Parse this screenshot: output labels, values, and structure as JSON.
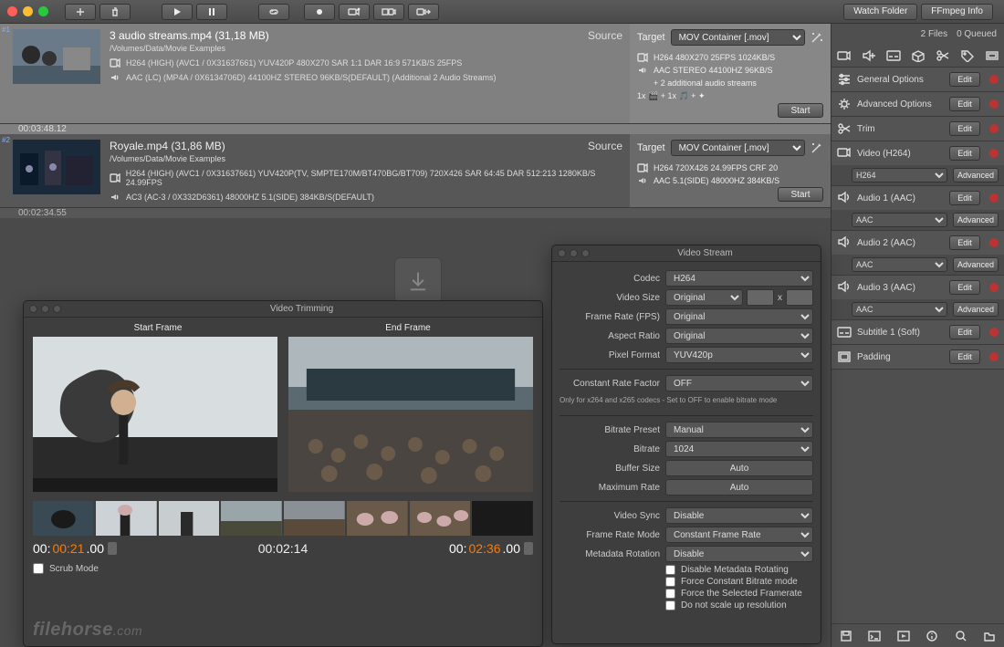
{
  "toolbar": {
    "watch_folder": "Watch Folder",
    "ffmpeg_info": "FFmpeg Info"
  },
  "status": {
    "files": "2 Files",
    "queued": "0 Queued"
  },
  "queue": [
    {
      "idx": "#1",
      "title": "3 audio streams.mp4  (31,18 MB)",
      "path": "/Volumes/Data/Movie Examples",
      "video_spec": "H264 (HIGH) (AVC1 / 0X31637661)  YUV420P 480X270 SAR 1:1 DAR 16:9 571KB/S 25FPS",
      "audio_spec": "AAC (LC) (MP4A / 0X6134706D) 44100HZ STEREO 96KB/S(DEFAULT) (Additional 2 Audio Streams)",
      "duration": "00:03:48.12",
      "source_label": "Source",
      "target": {
        "label": "Target",
        "container": "MOV Container [.mov]",
        "lines": [
          "H264 480X270 25FPS 1024KB/S",
          "AAC STEREO 44100HZ 96KB/S",
          "+ 2 additional audio streams"
        ],
        "mix": "1x 🎬 + 1x 🎵 + ✦",
        "start": "Start"
      }
    },
    {
      "idx": "#2",
      "title": "Royale.mp4  (31,86 MB)",
      "path": "/Volumes/Data/Movie Examples",
      "video_spec": "H264 (HIGH) (AVC1 / 0X31637661)  YUV420P(TV, SMPTE170M/BT470BG/BT709) 720X426 SAR 64:45 DAR 512:213 1280KB/S 24.99FPS",
      "audio_spec": "AC3 (AC-3 / 0X332D6361) 48000HZ 5.1(SIDE) 384KB/S(DEFAULT)",
      "duration": "00:02:34.55",
      "source_label": "Source",
      "target": {
        "label": "Target",
        "container": "MOV Container [.mov]",
        "lines": [
          "H264 720X426 24.99FPS CRF 20",
          "AAC 5.1(SIDE) 48000HZ 384KB/S"
        ],
        "start": "Start"
      }
    }
  ],
  "trimming": {
    "title": "Video Trimming",
    "start_head": "Start Frame",
    "end_head": "End Frame",
    "start_tc_pre": "00:",
    "start_tc_hl": "00:21",
    "start_tc_post": ".00",
    "mid_tc": "00:02:14",
    "end_tc_pre": "00:",
    "end_tc_hl": "02:36",
    "end_tc_post": ".00",
    "scrub": "Scrub Mode",
    "watermark": "filehorse",
    "watermark_dom": ".com"
  },
  "video_stream": {
    "title": "Video Stream",
    "labels": {
      "codec": "Codec",
      "videosize": "Video Size",
      "fps": "Frame Rate (FPS)",
      "aspect": "Aspect Ratio",
      "pixfmt": "Pixel Format",
      "crf": "Constant Rate Factor",
      "note": "Only for x264 and x265 codecs   -   Set to OFF to enable bitrate mode",
      "preset": "Bitrate Preset",
      "bitrate": "Bitrate",
      "buffer": "Buffer Size",
      "maxrate": "Maximum Rate",
      "vsync": "Video Sync",
      "frmode": "Frame Rate Mode",
      "mrot": "Metadata Rotation",
      "auto": "Auto"
    },
    "values": {
      "codec": "H264",
      "videosize": "Original",
      "fps": "Original",
      "aspect": "Original",
      "pixfmt": "YUV420p",
      "crf": "OFF",
      "preset": "Manual",
      "bitrate": "1024",
      "vsync": "Disable",
      "frmode": "Constant Frame Rate",
      "mrot": "Disable",
      "x": "x"
    },
    "checks": [
      "Disable Metadata Rotating",
      "Force Constant Bitrate mode",
      "Force the Selected Framerate",
      "Do not scale up resolution"
    ]
  },
  "sidebar": {
    "sections": [
      {
        "label": "General Options",
        "btn": "Edit",
        "adv": false
      },
      {
        "label": "Advanced Options",
        "btn": "Edit",
        "adv": false
      },
      {
        "label": "Trim",
        "btn": "Edit",
        "adv": false
      },
      {
        "label": "Video (H264)",
        "btn": "Edit",
        "adv": true,
        "sub_sel": "H264",
        "sub_btn": "Advanced"
      },
      {
        "label": "Audio 1 (AAC)",
        "btn": "Edit",
        "adv": true,
        "sub_sel": "AAC",
        "sub_btn": "Advanced"
      },
      {
        "label": "Audio 2 (AAC)",
        "btn": "Edit",
        "adv": true,
        "sub_sel": "AAC",
        "sub_btn": "Advanced"
      },
      {
        "label": "Audio 3 (AAC)",
        "btn": "Edit",
        "adv": true,
        "sub_sel": "AAC",
        "sub_btn": "Advanced"
      },
      {
        "label": "Subtitle 1 (Soft)",
        "btn": "Edit",
        "adv": false
      },
      {
        "label": "Padding",
        "btn": "Edit",
        "adv": false
      }
    ]
  }
}
